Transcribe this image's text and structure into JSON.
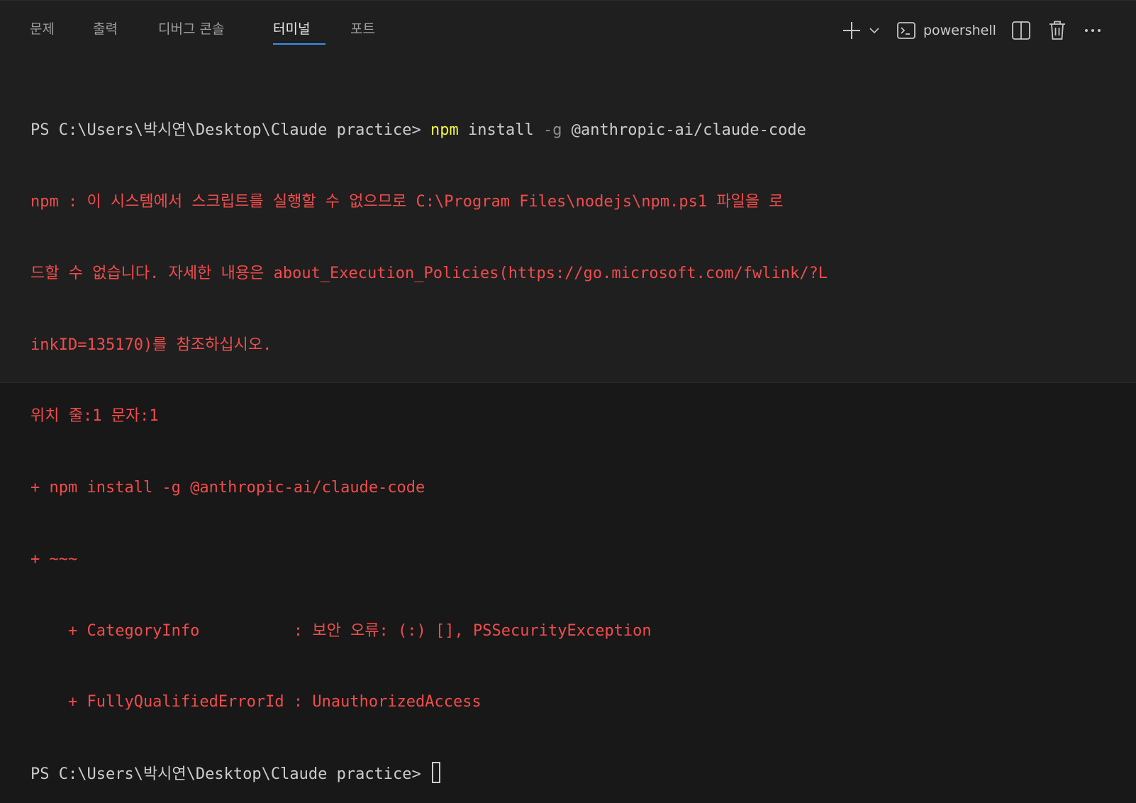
{
  "tabs": [
    {
      "label": "문제",
      "active": false
    },
    {
      "label": "출력",
      "active": false
    },
    {
      "label": "디버그 콘솔",
      "active": false
    },
    {
      "label": "터미널",
      "active": true
    },
    {
      "label": "포트",
      "active": false
    }
  ],
  "toolbar": {
    "new_terminal_icon": "plus-icon",
    "dropdown_icon": "chevron-down-icon",
    "shell_icon": "terminal-icon",
    "shell_label": "powershell",
    "split_icon": "split-panel-icon",
    "kill_icon": "trash-icon",
    "more_icon": "ellipsis-icon"
  },
  "terminal": {
    "prompt1": "PS C:\\Users\\박시연\\Desktop\\Claude practice> ",
    "cmd_npm": "npm",
    "cmd_install": " install ",
    "cmd_flag": "-g",
    "cmd_pkg": " @anthropic-ai/claude-code",
    "error_lines": [
      "npm : 이 시스템에서 스크립트를 실행할 수 없으므로 C:\\Program Files\\nodejs\\npm.ps1 파일을 로",
      "드할 수 없습니다. 자세한 내용은 about_Execution_Policies(https://go.microsoft.com/fwlink/?L",
      "inkID=135170)를 참조하십시오.",
      "위치 줄:1 문자:1",
      "+ npm install -g @anthropic-ai/claude-code",
      "+ ~~~",
      "    + CategoryInfo          : 보안 오류: (:) [], PSSecurityException",
      "    + FullyQualifiedErrorId : UnauthorizedAccess"
    ],
    "prompt2": "PS C:\\Users\\박시연\\Desktop\\Claude practice> "
  },
  "colors": {
    "background": "#1f1f1f",
    "error": "#f14c4c",
    "npm_highlight": "#f5f543",
    "accent": "#3b8eea"
  }
}
